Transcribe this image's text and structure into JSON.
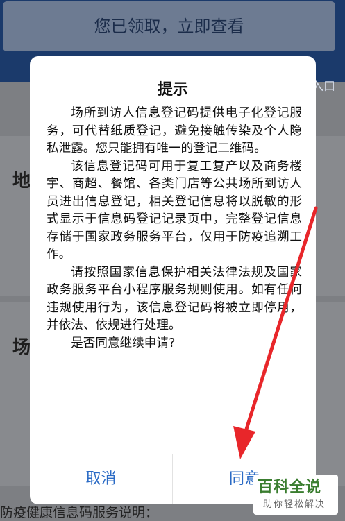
{
  "background": {
    "banner_button": "您已领取，立即查看",
    "entry_fragment": "页入口",
    "card1_label": "地",
    "card2_label": "场",
    "bottom_note": "防疫健康信息码服务说明："
  },
  "dialog": {
    "title": "提示",
    "paragraphs": [
      "场所到访人信息登记码提供电子化登记服务，可代替纸质登记，避免接触传染及个人隐私泄露。您只能拥有唯一的登记二维码。",
      "该信息登记码可用于复工复产以及商务楼宇、商超、餐馆、各类门店等公共场所到访人员进出信息登记，相关登记信息将以脱敏的形式显示于信息码登记记录页中，完整登记信息存储于国家政务服务平台，仅用于防疫追溯工作。",
      "请按照国家信息保护相关法律法规及国家政务服务平台小程序服务规则使用。如有任何违规使用行为，该信息登记码将被立即停用，并依法、依规进行处理。",
      "是否同意继续申请?"
    ],
    "cancel_label": "取消",
    "agree_label": "同意"
  },
  "watermark": {
    "title": "百科全说",
    "subtitle": "助你轻松解决"
  },
  "colors": {
    "accent": "#2b6bc5",
    "annotation_arrow": "#e8262a",
    "watermark_green": "#3a7d2f"
  }
}
